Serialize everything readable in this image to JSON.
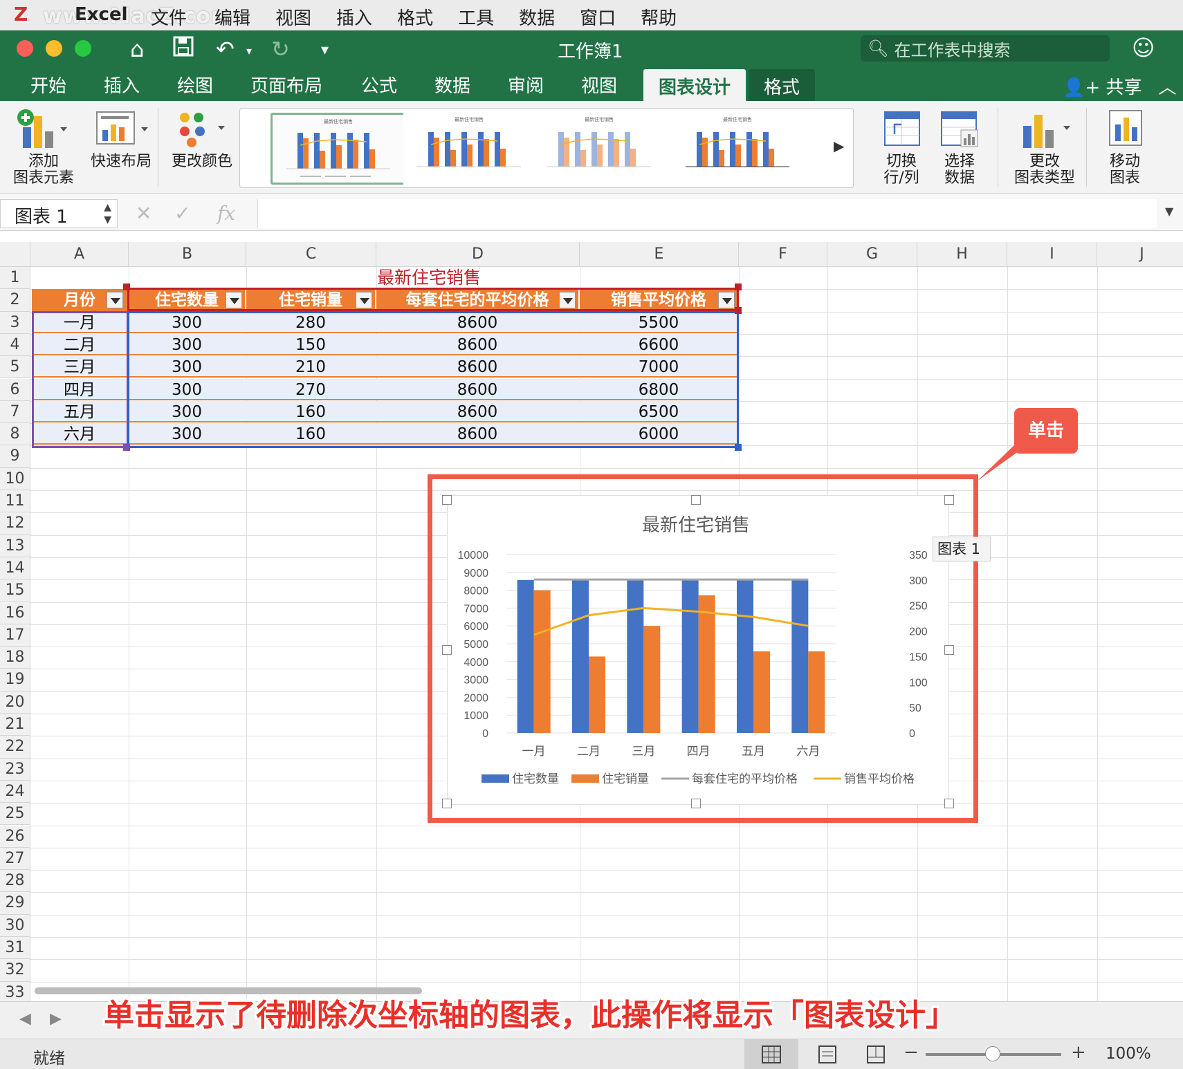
{
  "menubar": {
    "watermark": "www.MacZ.com",
    "app_name": "Excel",
    "items": [
      "文件",
      "编辑",
      "视图",
      "插入",
      "格式",
      "工具",
      "数据",
      "窗口",
      "帮助"
    ]
  },
  "titlebar": {
    "title": "工作簿1",
    "search_placeholder": "在工作表中搜索"
  },
  "tabs": [
    "开始",
    "插入",
    "绘图",
    "页面布局",
    "公式",
    "数据",
    "审阅",
    "视图",
    "图表设计",
    "格式"
  ],
  "share_label": "共享",
  "ribbon": {
    "add_element": [
      "添加",
      "图表元素"
    ],
    "quick_layout": "快速布局",
    "change_colors": "更改颜色",
    "switch_row_col": [
      "切换",
      "行/列"
    ],
    "select_data": [
      "选择",
      "数据"
    ],
    "change_type": [
      "更改",
      "图表类型"
    ],
    "move_chart": [
      "移动",
      "图表"
    ],
    "gallery_title": "最新住宅销售"
  },
  "formula_bar": {
    "name_box": "图表 1",
    "fx": "fx"
  },
  "sheet": {
    "columns": [
      "A",
      "B",
      "C",
      "D",
      "E",
      "F",
      "G",
      "H",
      "I",
      "J"
    ],
    "rows": [
      "1",
      "2",
      "3",
      "4",
      "5",
      "6",
      "7",
      "8",
      "9",
      "10",
      "11",
      "12",
      "13",
      "14",
      "15",
      "16",
      "17",
      "18",
      "19",
      "20",
      "21",
      "22",
      "23",
      "24",
      "25",
      "26",
      "27",
      "28",
      "29",
      "30",
      "31",
      "32",
      "33"
    ],
    "title": "最新住宅销售",
    "headers": [
      "月份",
      "住宅数量",
      "住宅销量",
      "每套住宅的平均价格",
      "销售平均价格"
    ],
    "data": [
      [
        "一月",
        "300",
        "280",
        "8600",
        "5500"
      ],
      [
        "二月",
        "300",
        "150",
        "8600",
        "6600"
      ],
      [
        "三月",
        "300",
        "210",
        "8600",
        "7000"
      ],
      [
        "四月",
        "300",
        "270",
        "8600",
        "6800"
      ],
      [
        "五月",
        "300",
        "160",
        "8600",
        "6500"
      ],
      [
        "六月",
        "300",
        "160",
        "8600",
        "6000"
      ]
    ]
  },
  "chart_label": "图表 1",
  "callout": "单击",
  "caption": "单击显示了待删除次坐标轴的图表，此操作将显示「图表设计」",
  "status": {
    "ready": "就绪",
    "zoom": "100%"
  },
  "chart_data": {
    "type": "bar",
    "title": "最新住宅销售",
    "categories": [
      "一月",
      "二月",
      "三月",
      "四月",
      "五月",
      "六月"
    ],
    "ylim": [
      0,
      10000
    ],
    "y_ticks": [
      "10000",
      "9000",
      "8000",
      "7000",
      "6000",
      "5000",
      "4000",
      "3000",
      "2000",
      "1000",
      "0"
    ],
    "y2lim": [
      0,
      350
    ],
    "y2_ticks": [
      "350",
      "300",
      "250",
      "200",
      "150",
      "100",
      "50",
      "0"
    ],
    "series": [
      {
        "name": "住宅数量",
        "type": "bar",
        "axis": "secondary",
        "color": "#4472c4",
        "values": [
          300,
          300,
          300,
          300,
          300,
          300
        ]
      },
      {
        "name": "住宅销量",
        "type": "bar",
        "axis": "secondary",
        "color": "#ed7d31",
        "values": [
          280,
          150,
          210,
          270,
          160,
          160
        ]
      },
      {
        "name": "每套住宅的平均价格",
        "type": "line",
        "axis": "primary",
        "color": "#a5a5a5",
        "values": [
          8600,
          8600,
          8600,
          8600,
          8600,
          8600
        ]
      },
      {
        "name": "销售平均价格",
        "type": "line",
        "axis": "primary",
        "color": "#f0b323",
        "values": [
          5500,
          6600,
          7000,
          6800,
          6500,
          6000
        ]
      }
    ],
    "legend": "bottom",
    "grid": true
  }
}
